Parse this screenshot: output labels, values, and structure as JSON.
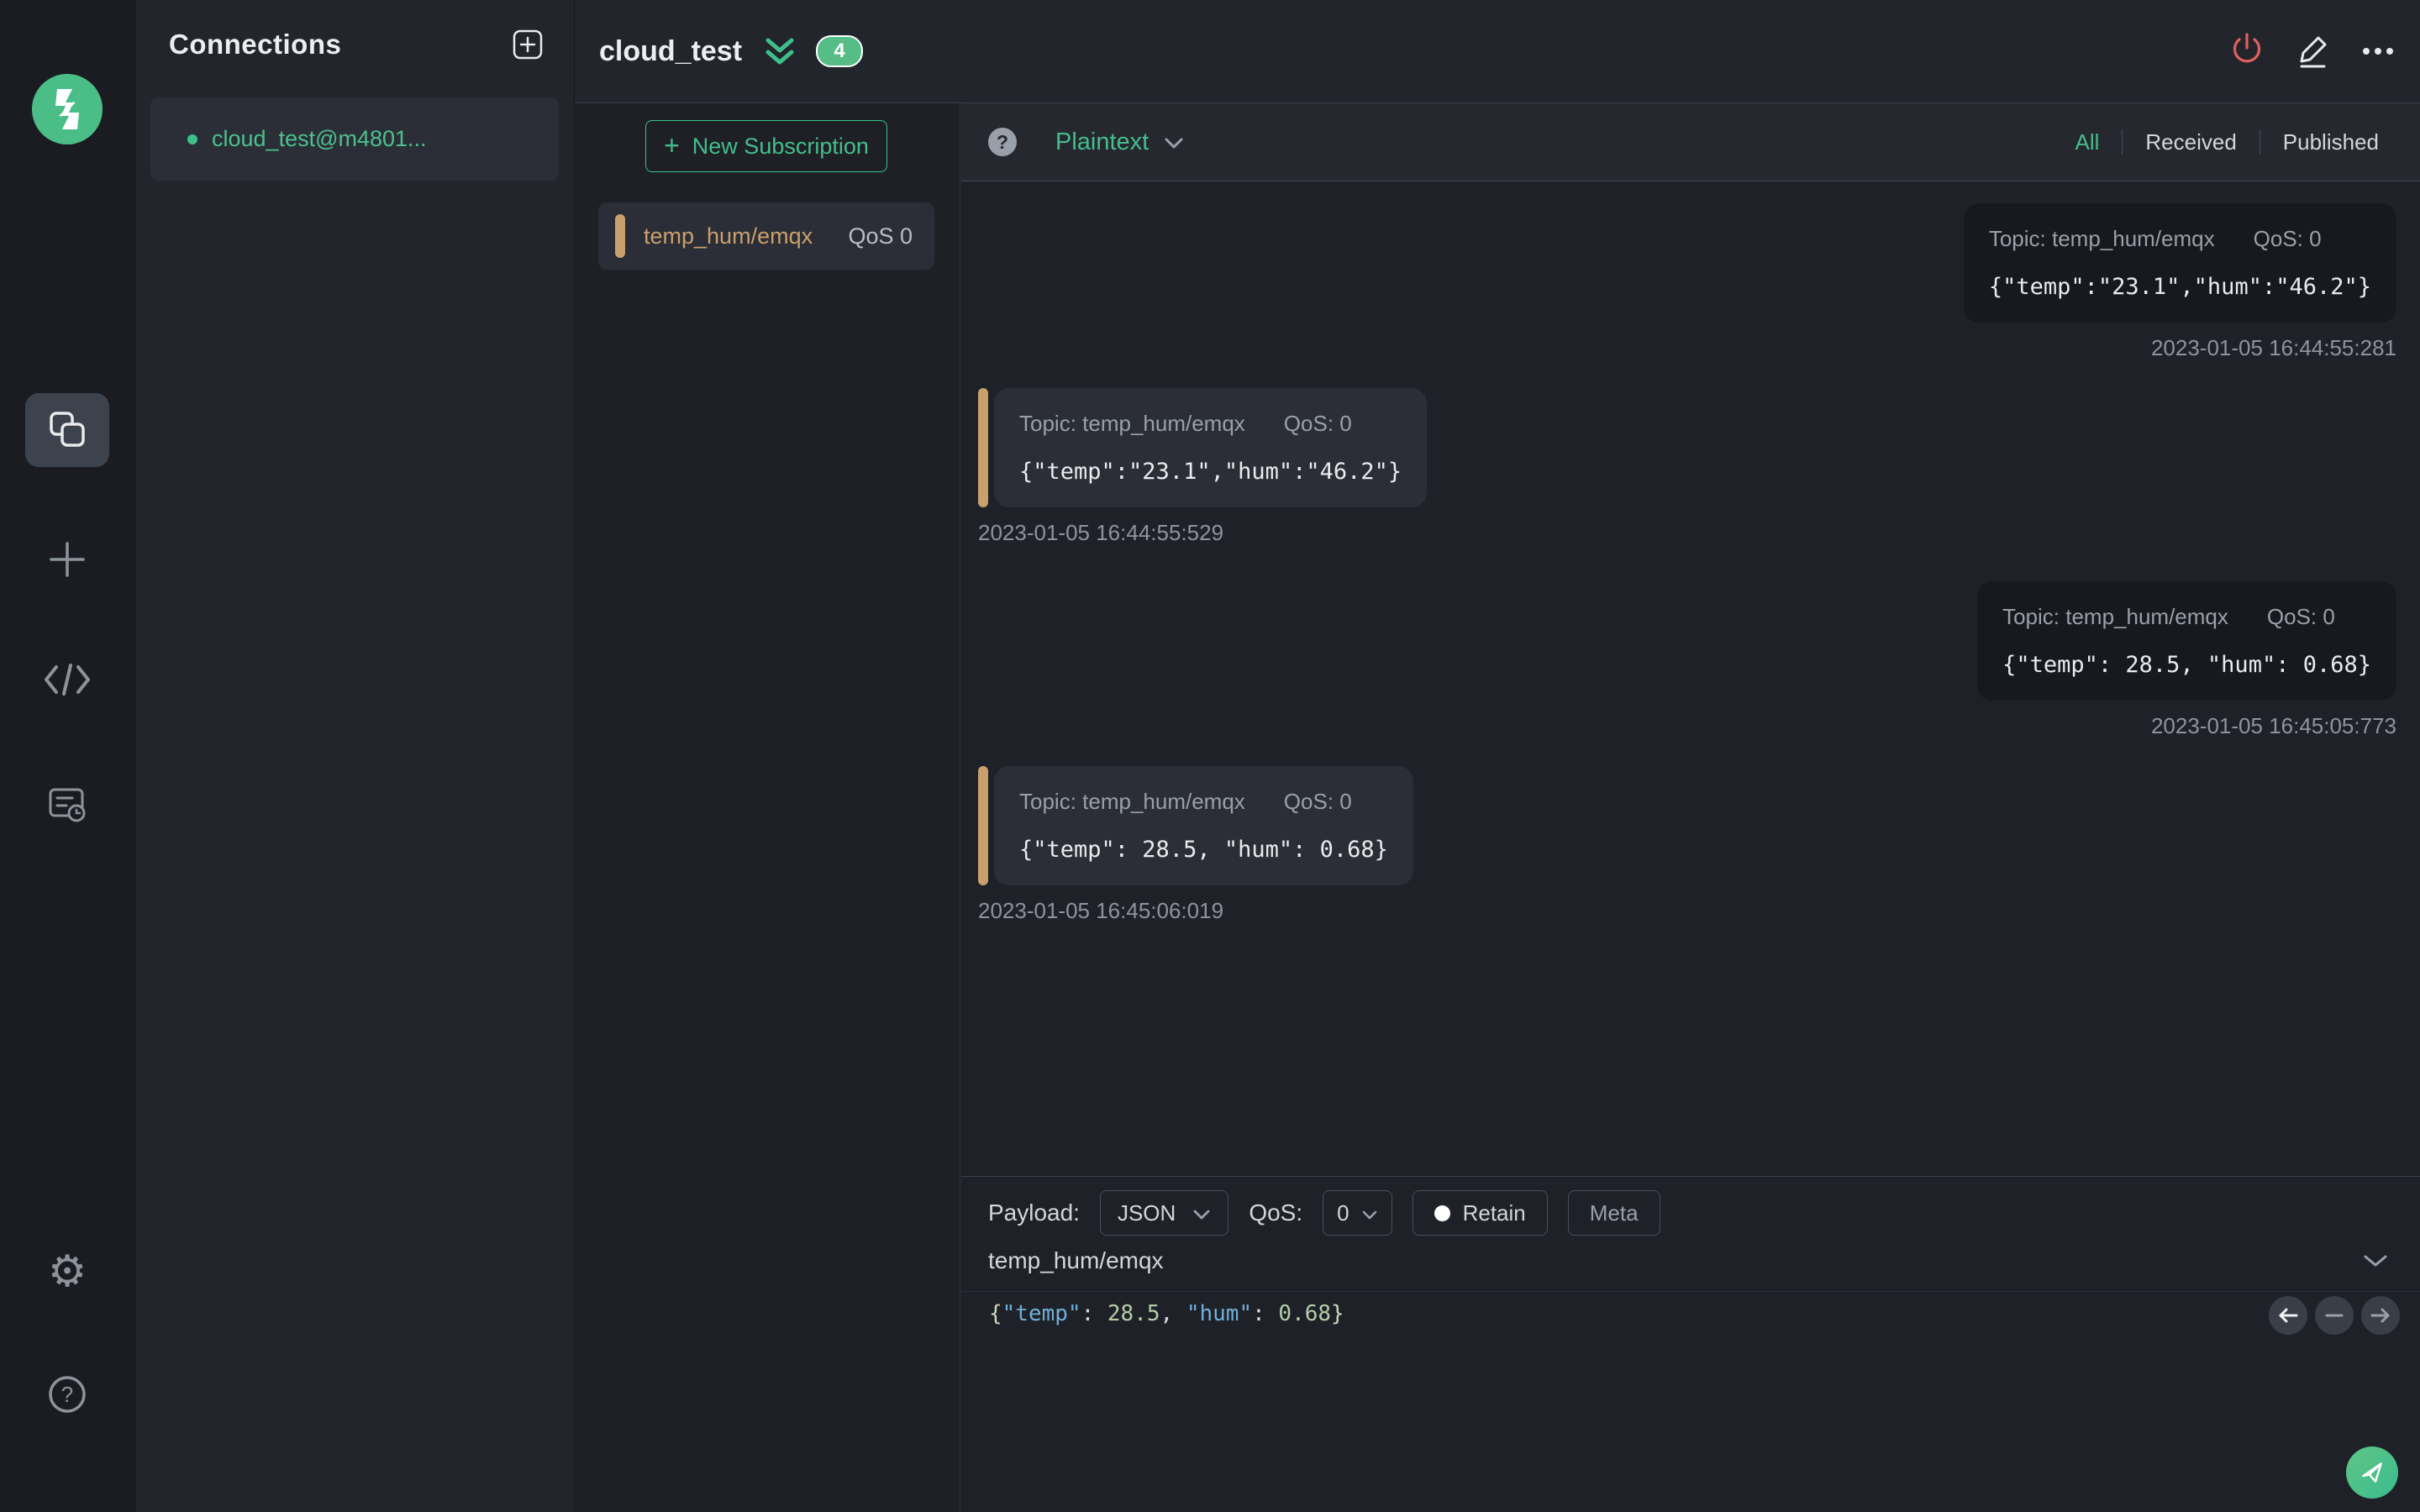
{
  "colors": {
    "accent_green": "#34c388",
    "accent_tan": "#c9a06d",
    "danger_red": "#e0615e",
    "bg_dark": "#1f2128",
    "card_received": "#17191f",
    "card_published": "#2b2e36"
  },
  "sidebar": {
    "icons": [
      "mqttx-logo",
      "connections",
      "new-connection",
      "script",
      "log",
      "settings",
      "help"
    ]
  },
  "connections_panel": {
    "title": "Connections",
    "items": [
      {
        "name": "cloud_test@m4801...",
        "status": "connected"
      }
    ]
  },
  "header": {
    "title": "cloud_test",
    "badge_count": "4",
    "actions": [
      "disconnect",
      "edit",
      "more"
    ]
  },
  "subscriptions": {
    "new_button_label": "New Subscription",
    "plus_glyph": "+",
    "items": [
      {
        "topic": "temp_hum/emqx",
        "qos_label": "QoS 0"
      }
    ]
  },
  "toolbar": {
    "help_glyph": "?",
    "format": "Plaintext",
    "filters": [
      {
        "label": "All",
        "active": true
      },
      {
        "label": "Received",
        "active": false
      },
      {
        "label": "Published",
        "active": false
      }
    ]
  },
  "messages": [
    {
      "direction": "received",
      "topic_label": "Topic: temp_hum/emqx",
      "qos_label": "QoS: 0",
      "payload": "{\"temp\":\"23.1\",\"hum\":\"46.2\"}",
      "timestamp": "2023-01-05 16:44:55:281"
    },
    {
      "direction": "published",
      "topic_label": "Topic: temp_hum/emqx",
      "qos_label": "QoS: 0",
      "payload": "{\"temp\":\"23.1\",\"hum\":\"46.2\"}",
      "timestamp": "2023-01-05 16:44:55:529"
    },
    {
      "direction": "received",
      "topic_label": "Topic: temp_hum/emqx",
      "qos_label": "QoS: 0",
      "payload": "{\"temp\": 28.5, \"hum\": 0.68}",
      "timestamp": "2023-01-05 16:45:05:773"
    },
    {
      "direction": "published",
      "topic_label": "Topic: temp_hum/emqx",
      "qos_label": "QoS: 0",
      "payload": "{\"temp\": 28.5, \"hum\": 0.68}",
      "timestamp": "2023-01-05 16:45:06:019"
    }
  ],
  "publish": {
    "payload_label": "Payload:",
    "format_value": "JSON",
    "qos_label": "QoS:",
    "qos_value": "0",
    "retain_label": "Retain",
    "meta_label": "Meta",
    "topic_value": "temp_hum/emqx",
    "payload_text": "{\"temp\": 28.5, \"hum\": 0.68}",
    "payload_tokens": [
      {
        "text": "{",
        "type": "brace"
      },
      {
        "text": "\"temp\"",
        "type": "key"
      },
      {
        "text": ": ",
        "type": "punct"
      },
      {
        "text": "28.5",
        "type": "num"
      },
      {
        "text": ", ",
        "type": "punct"
      },
      {
        "text": "\"hum\"",
        "type": "key"
      },
      {
        "text": ": ",
        "type": "punct"
      },
      {
        "text": "0.68",
        "type": "num"
      },
      {
        "text": "}",
        "type": "brace"
      }
    ]
  }
}
